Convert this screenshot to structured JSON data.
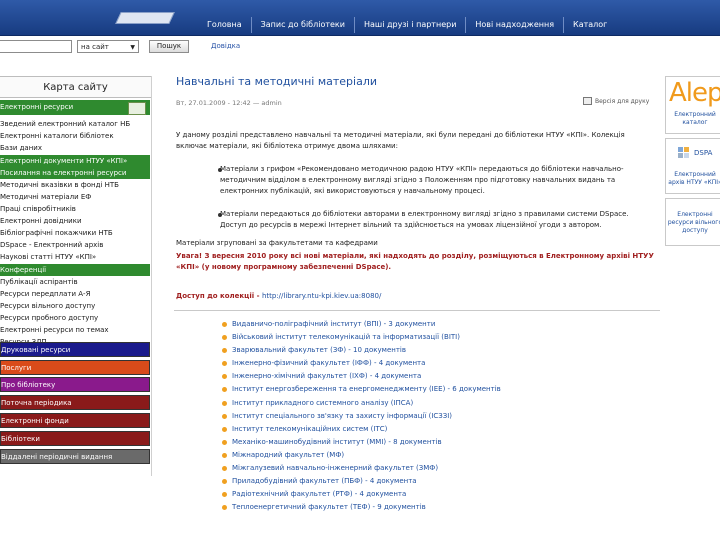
{
  "nav": {
    "items": [
      "Головна",
      "Запис до бібліотеки",
      "Наші друзі і партнери",
      "Нові надходження",
      "Каталог"
    ]
  },
  "search": {
    "input_value": "",
    "select_value": "на сайт",
    "button_label": "Пошук",
    "help_link": "Довідка"
  },
  "sidebar": {
    "title": "Карта сайту",
    "items": [
      "Електронні ресурси",
      "Зведений електронний каталог НБ",
      "Електронні каталоги бібліотек",
      "Бази даних",
      "Електронні документи НТУУ «КПІ»",
      "Посилання на електронні ресурси",
      "Методичні вказівки в фонді НТБ",
      "Методичні матеріали ЕФ",
      "Праці співробітників",
      "Електронні довідники",
      "Бібліографічні покажчики НТБ",
      "DSpace - Електронний архів",
      "Наукові статті НТУУ «КПІ»",
      "Конференції",
      "Публікації аспірантів",
      "Ресурси передплати А-Я",
      "Ресурси вільного доступу",
      "Ресурси пробного доступу",
      "Електронні ресурси по темах",
      "Ресурси ЗЛП",
      "Друковані ресурси",
      "Послуги",
      "Про бібліотеку",
      "Поточна періодика",
      "Електронні фонди",
      "Бібліотеки",
      "Віддалені періодичні видання"
    ],
    "colors": [
      "#1a1a8c",
      "#d94b1a",
      "#8a1a8c",
      "#8a1a1a",
      "#8a1a1a",
      "#8a1a1a",
      "#6a6a6a"
    ]
  },
  "main": {
    "title": "Навчальні та методичні матеріали",
    "meta": "Вт, 27.01.2009 - 12:42 — admin",
    "versions_link": "Версія для друку",
    "intro": "У даному розділі представлено навчальні та методичні матеріали, які були передані до бібліотеки НТУУ «КПІ». Колекція включає матеріали, які бібліотека отримує двома шляхами:",
    "bullet1": "Матеріали з грифом «Рекомендовано методичною радою НТУУ «КПІ» передаються до бібліотеки навчально-методичним відділом в електронному вигляді згідно з Положенням про підготовку навчальних видань та електронних публікацій, які використовуються у навчальному процесі.",
    "bullet2": "Матеріали передаються до бібліотеки авторами в електронному вигляді згідно з правилами системи DSpace. Доступ до ресурсів в мережі Інтернет вільний та здійснюється на умовах ліцензійної угоди з автором.",
    "grouped": "Матеріали згруповані за факультетами та кафедрами",
    "notice": "Увага! З вересня 2010 року всі нові матеріали, які надходять до розділу, розміщуються в Електронному архіві НТУУ «КПІ» (у новому програмному забезпеченні DSpace).",
    "access_label": "Доступ до колекції -",
    "access_url": "http://library.ntu-kpi.kiev.ua:8080/",
    "collections": [
      "Видавничо-поліграфічний інститут (ВПІ) - 3 документи",
      "Військовий інститут телекомунікацій та інформатизації (ВІТІ)",
      "Зварювальний факультет (ЗФ) - 10 документів",
      "Інженерно-фізичний факультет (ІФФ) - 4 документа",
      "Інженерно-хімічний факультет (ІХФ) - 4 документа",
      "Інститут енергозбереження та енергоменеджменту (ІЕЕ) - 6 документів",
      "Інститут прикладного системного аналізу (ІПСА)",
      "Інститут спеціального зв'язку та захисту інформації (ІСЗЗІ)",
      "Інститут телекомунікаційних систем (ІТС)",
      "Механіко-машинобудівний інститут (ММІ) - 8 документів",
      "Міжнародний факультет (МФ)",
      "Міжгалузевий навчально-інженерний факультет (ЗМФ)",
      "Приладобудівний факультет (ПБФ) - 4 документа",
      "Радіотехнічний факультет (РТФ) - 4 документа",
      "Теплоенергетичний факультет (ТЕФ) - 9 документів"
    ]
  },
  "rightbar": {
    "aleph_logo": "Alep",
    "aleph_caption": "Електронний каталог",
    "dspace_logo": "DSPA",
    "dspace_caption": "Електронний архів НТУУ «КПІ»",
    "third_caption": "Електронні ресурси вільного доступу"
  },
  "colors": {
    "topbar": "#173b80",
    "sidebar_green": "#2f8a2f",
    "link": "#1f4f9e",
    "notice": "#a02020",
    "bullet_orange": "#f0a020"
  }
}
